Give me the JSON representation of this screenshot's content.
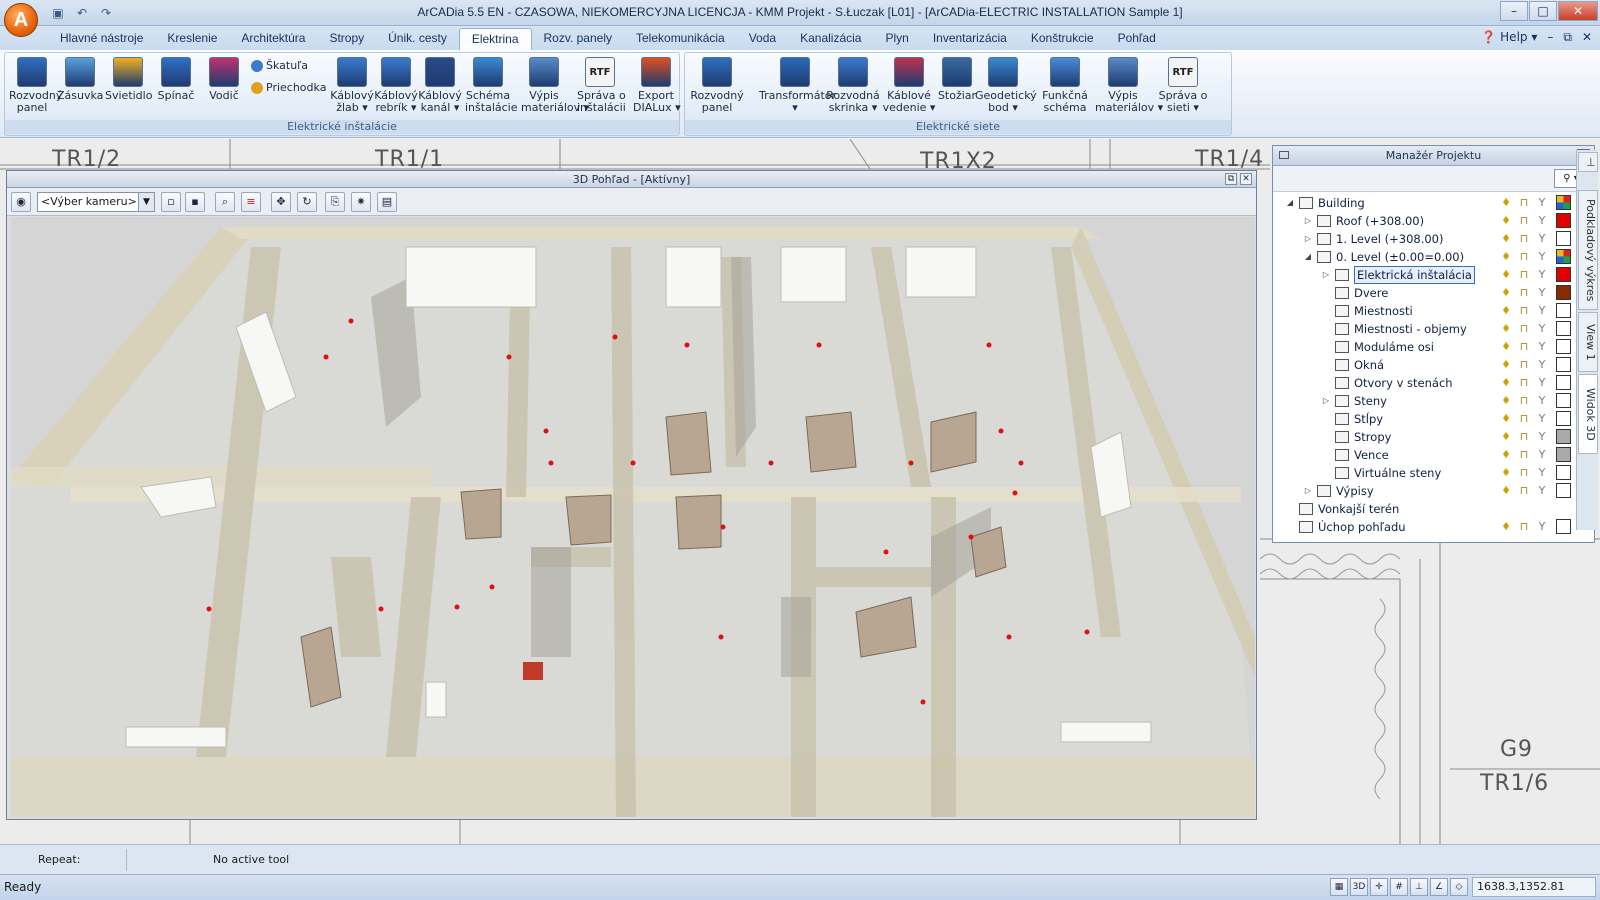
{
  "window": {
    "title": "ArCADia 5.5 EN - CZASOWA, NIEKOMERCYJNA LICENCJA - KMM Projekt - S.Łuczak [L01] - [ArCADia-ELECTRIC INSTALLATION Sample 1]",
    "logo_letter": "A"
  },
  "tabs": [
    "Hlavné nástroje",
    "Kreslenie",
    "Architektúra",
    "Stropy",
    "Únik. cesty",
    "Elektrina",
    "Rozv. panely",
    "Telekomunikácia",
    "Voda",
    "Kanalizácia",
    "Plyn",
    "Inventarizácia",
    "Konštrukcie",
    "Pohľad"
  ],
  "active_tab": "Elektrina",
  "help": {
    "label": "Help"
  },
  "ribbon": {
    "group1": {
      "title": "Elektrické inštalácie",
      "buttons": [
        {
          "l1": "Rozvodný",
          "l2": "panel"
        },
        {
          "l1": "Zásuvka",
          "l2": ""
        },
        {
          "l1": "Svietidlo",
          "l2": ""
        },
        {
          "l1": "Spínač",
          "l2": ""
        },
        {
          "l1": "Vodič",
          "l2": ""
        },
        {
          "l1": "Káblový",
          "l2": "žlab ▾"
        },
        {
          "l1": "Káblový",
          "l2": "rebrík ▾"
        },
        {
          "l1": "Káblový",
          "l2": "kanál ▾"
        },
        {
          "l1": "Schéma",
          "l2": "inštalácie"
        },
        {
          "l1": "Výpis",
          "l2": "materiálov ▾"
        },
        {
          "l1": "Správa o",
          "l2": "inštalácii"
        },
        {
          "l1": "Export",
          "l2": "DIALux ▾"
        }
      ],
      "small": [
        "Škatuľa",
        "Priechodka"
      ]
    },
    "group2": {
      "title": "Elektrické siete",
      "buttons": [
        {
          "l1": "Rozvodný",
          "l2": "panel"
        },
        {
          "l1": "Transformátor",
          "l2": "▾"
        },
        {
          "l1": "Rozvodná",
          "l2": "skrinka ▾"
        },
        {
          "l1": "Káblové",
          "l2": "vedenie ▾"
        },
        {
          "l1": "Stožiar",
          "l2": ""
        },
        {
          "l1": "Geodetický",
          "l2": "bod ▾"
        },
        {
          "l1": "Funkčná",
          "l2": "schéma"
        },
        {
          "l1": "Výpis",
          "l2": "materiálov ▾"
        },
        {
          "l1": "Správa o",
          "l2": "sieti ▾"
        }
      ]
    },
    "rtf_label": "RTF"
  },
  "cad_labels": [
    "TR1/2",
    "TR1/1",
    "TR1X2",
    "TR1/4",
    "G9",
    "TR1/6"
  ],
  "view3d": {
    "title": "3D Pohľad - [Aktívny]",
    "camera_placeholder": "<Výber kameru>"
  },
  "project_manager": {
    "title": "Manažér Projektu",
    "tree": [
      {
        "label": "Building",
        "level": 0,
        "expand": "◢",
        "swatch": "multi",
        "flags": true
      },
      {
        "label": "Roof (+308.00)",
        "level": 1,
        "expand": "▷",
        "swatch": "#e00000",
        "flags": true
      },
      {
        "label": "1. Level (+308.00)",
        "level": 1,
        "expand": "▷",
        "swatch": "#ffffff",
        "flags": true
      },
      {
        "label": "0. Level (±0.00=0.00)",
        "level": 1,
        "expand": "◢",
        "swatch": "multi",
        "flags": true
      },
      {
        "label": "Elektrická inštalácia",
        "level": 2,
        "expand": "▷",
        "swatch": "#e00000",
        "flags": true,
        "selected": true
      },
      {
        "label": "Dvere",
        "level": 2,
        "expand": "",
        "swatch": "#8a2a00",
        "flags": true
      },
      {
        "label": "Miestnosti",
        "level": 2,
        "expand": "",
        "swatch": "#ffffff",
        "flags": true
      },
      {
        "label": "Miestnosti - objemy",
        "level": 2,
        "expand": "",
        "swatch": "#ffffff",
        "flags": true
      },
      {
        "label": "Moduláme osi",
        "level": 2,
        "expand": "",
        "swatch": "#ffffff",
        "flags": true
      },
      {
        "label": "Okná",
        "level": 2,
        "expand": "",
        "swatch": "#ffffff",
        "flags": true
      },
      {
        "label": "Otvory v stenách",
        "level": 2,
        "expand": "",
        "swatch": "#ffffff",
        "flags": true
      },
      {
        "label": "Steny",
        "level": 2,
        "expand": "▷",
        "swatch": "#ffffff",
        "flags": true
      },
      {
        "label": "Stĺpy",
        "level": 2,
        "expand": "",
        "swatch": "#ffffff",
        "flags": true
      },
      {
        "label": "Stropy",
        "level": 2,
        "expand": "",
        "swatch": "#aaaaaa",
        "flags": true
      },
      {
        "label": "Vence",
        "level": 2,
        "expand": "",
        "swatch": "#aaaaaa",
        "flags": true
      },
      {
        "label": "Virtuálne steny",
        "level": 2,
        "expand": "",
        "swatch": "#ffffff",
        "flags": true
      },
      {
        "label": "Výpisy",
        "level": 1,
        "expand": "▷",
        "swatch": "#ffffff",
        "flags": true
      },
      {
        "label": "Vonkajší terén",
        "level": 0,
        "expand": "",
        "swatch": "",
        "flags": false
      },
      {
        "label": "Úchop pohľadu",
        "level": 0,
        "expand": "",
        "swatch": "#ffffff",
        "flags": true
      }
    ],
    "side_tabs": [
      "Podkladový výkres",
      "View 1",
      "Widok 3D"
    ]
  },
  "cmdline": {
    "repeat_label": "Repeat:",
    "tool_status": "No active tool"
  },
  "status": {
    "ready": "Ready",
    "coords": "1638.3,1352.81"
  },
  "colors": {
    "accent": "#3a6cc0",
    "marker": "#e01010"
  }
}
